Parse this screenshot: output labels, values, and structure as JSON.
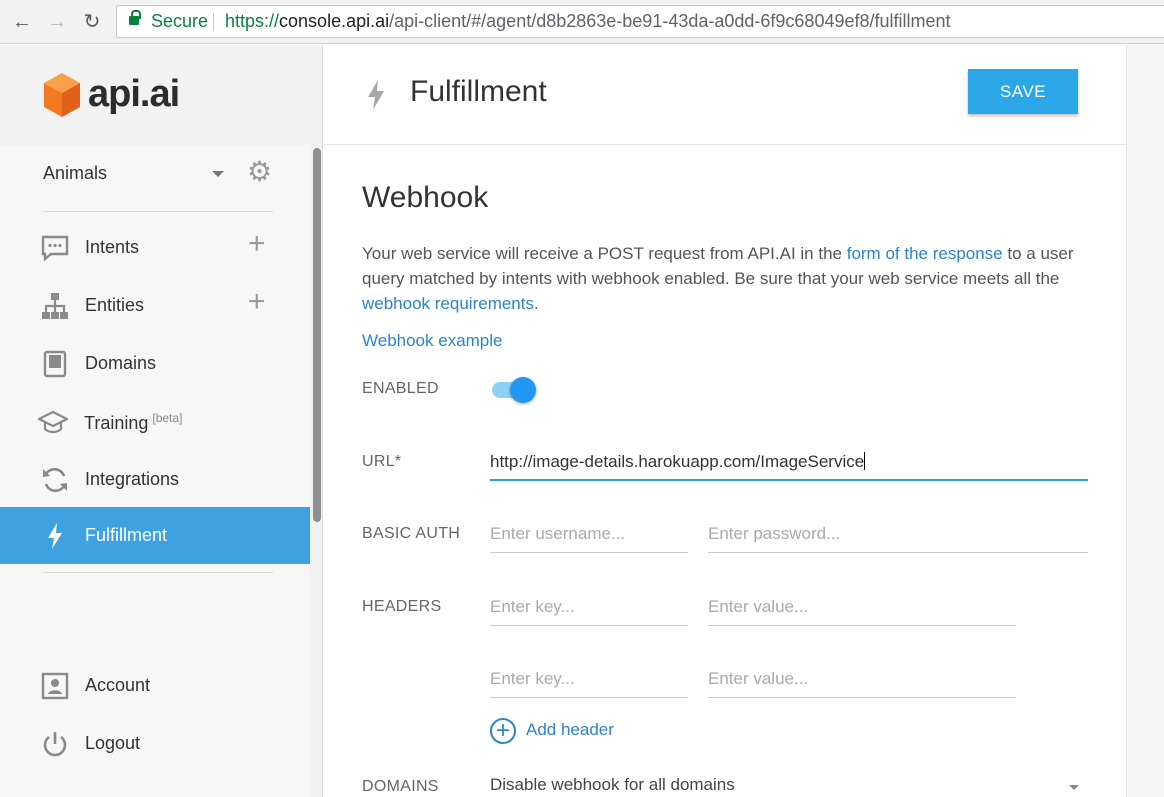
{
  "browser": {
    "secure_label": "Secure",
    "url_scheme": "https://",
    "url_host": "console.api.ai",
    "url_path": "/api-client/#/agent/d8b2863e-be91-43da-a0dd-6f9c68049ef8/fulfillment"
  },
  "logo": {
    "text": "api.ai"
  },
  "sidebar": {
    "agent": "Animals",
    "items": [
      {
        "label": "Intents",
        "icon": "chat-bubble-icon"
      },
      {
        "label": "Entities",
        "icon": "hierarchy-icon"
      },
      {
        "label": "Domains",
        "icon": "book-icon"
      },
      {
        "label": "Training",
        "badge": "[beta]",
        "icon": "graduation-cap-icon"
      },
      {
        "label": "Integrations",
        "icon": "refresh-icon"
      },
      {
        "label": "Fulfillment",
        "icon": "bolt-icon",
        "active": true
      }
    ],
    "bottom_items": [
      {
        "label": "Account",
        "icon": "account-icon"
      },
      {
        "label": "Logout",
        "icon": "power-icon"
      }
    ]
  },
  "header": {
    "title": "Fulfillment",
    "save_label": "SAVE"
  },
  "webhook": {
    "title": "Webhook",
    "desc_part1": "Your web service will receive a POST request from API.AI in the ",
    "desc_link1": "form of the response",
    "desc_part2": " to a user query matched by intents with webhook enabled. Be sure that your web service meets all the ",
    "desc_link2": "webhook requirements",
    "desc_part3": ".",
    "example_link": "Webhook example",
    "enabled_label": "ENABLED",
    "enabled": true,
    "url_label": "URL*",
    "url_value": "http://image-details.harokuapp.com/ImageService",
    "basic_auth_label": "BASIC AUTH",
    "username_placeholder": "Enter username...",
    "password_placeholder": "Enter password...",
    "headers_label": "HEADERS",
    "key_placeholder": "Enter key...",
    "value_placeholder": "Enter value...",
    "add_header_label": "Add header",
    "domains_label": "DOMAINS",
    "domains_value": "Disable webhook for all domains"
  },
  "colors": {
    "accent": "#2ba7e8",
    "active_nav": "#3ea2e1",
    "link": "#2a85c8",
    "logo_orange": "#f47a20"
  }
}
